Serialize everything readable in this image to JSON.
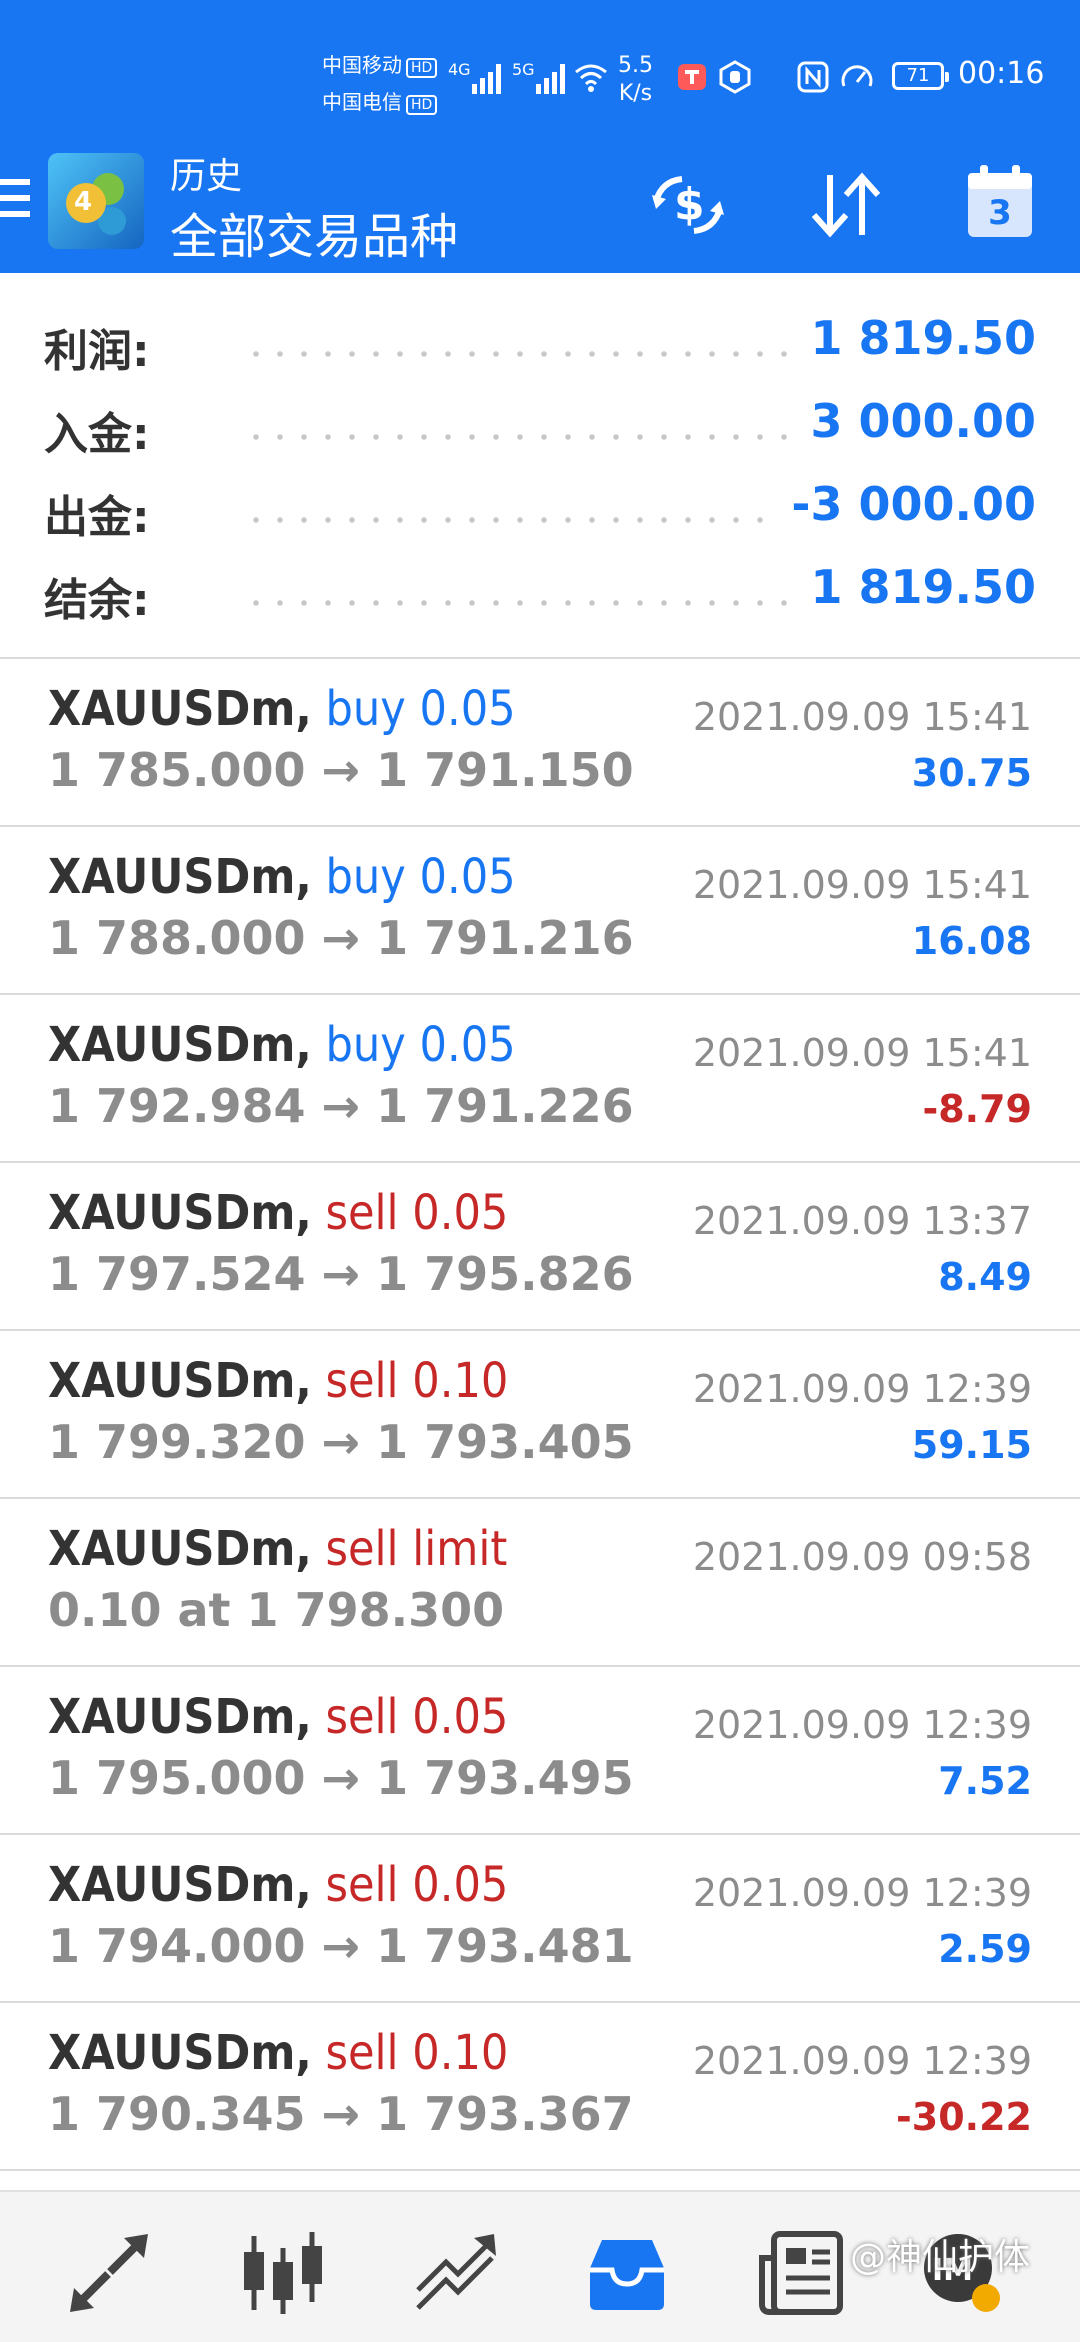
{
  "status_bar": {
    "carrier1": "中国移动",
    "carrier2": "中国电信",
    "hd": "HD",
    "net1": "4G",
    "net2": "5G",
    "speed_value": "5.5",
    "speed_unit": "K/s",
    "battery": "71",
    "time": "00:16"
  },
  "app_bar": {
    "subtitle": "历史",
    "title": "全部交易品种",
    "calendar_day": "3"
  },
  "summary": [
    {
      "label": "利润:",
      "value": "1 819.50"
    },
    {
      "label": "入金:",
      "value": "3 000.00"
    },
    {
      "label": "出金:",
      "value": "-3 000.00"
    },
    {
      "label": "结余:",
      "value": "1 819.50"
    }
  ],
  "trades": [
    {
      "symbol": "XAUUSDm,",
      "type": "buy 0.05",
      "side": "buy",
      "prices": "1 785.000 → 1 791.150",
      "time": "2021.09.09 15:41",
      "profit": "30.75",
      "sign": "pos"
    },
    {
      "symbol": "XAUUSDm,",
      "type": "buy 0.05",
      "side": "buy",
      "prices": "1 788.000 → 1 791.216",
      "time": "2021.09.09 15:41",
      "profit": "16.08",
      "sign": "pos"
    },
    {
      "symbol": "XAUUSDm,",
      "type": "buy 0.05",
      "side": "buy",
      "prices": "1 792.984 → 1 791.226",
      "time": "2021.09.09 15:41",
      "profit": "-8.79",
      "sign": "neg"
    },
    {
      "symbol": "XAUUSDm,",
      "type": "sell 0.05",
      "side": "sell",
      "prices": "1 797.524 → 1 795.826",
      "time": "2021.09.09 13:37",
      "profit": "8.49",
      "sign": "pos"
    },
    {
      "symbol": "XAUUSDm,",
      "type": "sell 0.10",
      "side": "sell",
      "prices": "1 799.320 → 1 793.405",
      "time": "2021.09.09 12:39",
      "profit": "59.15",
      "sign": "pos"
    },
    {
      "symbol": "XAUUSDm,",
      "type": "sell limit",
      "side": "sell",
      "prices": "0.10 at 1 798.300",
      "time": "2021.09.09 09:58",
      "profit": "",
      "sign": "pos"
    },
    {
      "symbol": "XAUUSDm,",
      "type": "sell 0.05",
      "side": "sell",
      "prices": "1 795.000 → 1 793.495",
      "time": "2021.09.09 12:39",
      "profit": "7.52",
      "sign": "pos"
    },
    {
      "symbol": "XAUUSDm,",
      "type": "sell 0.05",
      "side": "sell",
      "prices": "1 794.000 → 1 793.481",
      "time": "2021.09.09 12:39",
      "profit": "2.59",
      "sign": "pos"
    },
    {
      "symbol": "XAUUSDm,",
      "type": "sell 0.10",
      "side": "sell",
      "prices": "1 790.345 → 1 793.367",
      "time": "2021.09.09 12:39",
      "profit": "-30.22",
      "sign": "neg"
    }
  ],
  "bottom_nav": [
    {
      "name": "quotes-icon",
      "active": false
    },
    {
      "name": "chart-icon",
      "active": false
    },
    {
      "name": "trade-icon",
      "active": false
    },
    {
      "name": "history-icon",
      "active": true
    },
    {
      "name": "news-icon",
      "active": false
    },
    {
      "name": "messages-icon",
      "active": false
    }
  ],
  "watermark": "@神仙护体",
  "colors": {
    "primary": "#1976f2",
    "sell": "#c62828",
    "text": "#333333",
    "muted": "#8c8c8c"
  }
}
